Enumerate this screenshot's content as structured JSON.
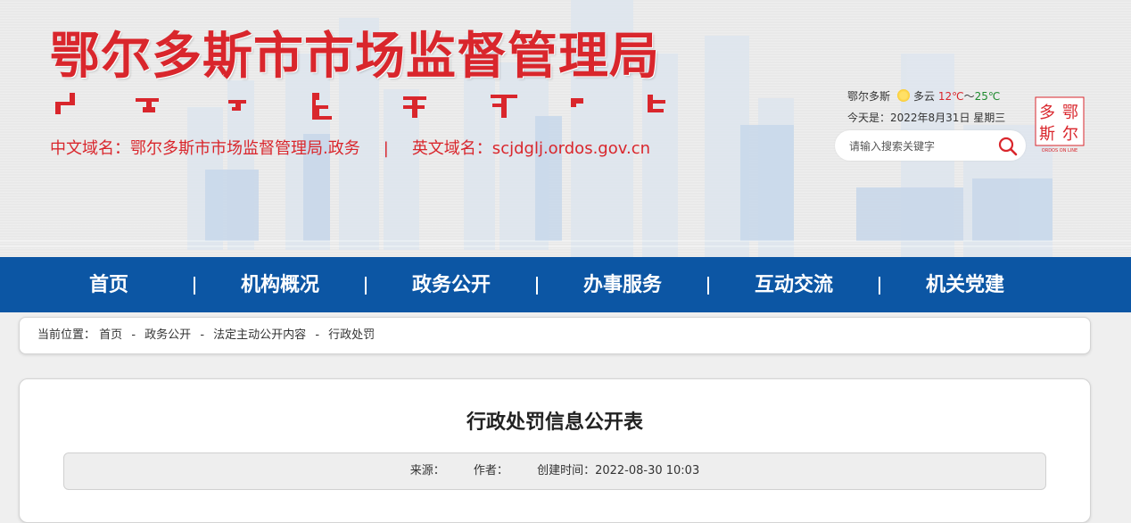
{
  "header": {
    "site_title": "鄂尔多斯市市场监督管理局",
    "cn_domain": "中文域名：鄂尔多斯市市场监督管理局.政务",
    "separator": "|",
    "en_domain": "英文域名：scjdglj.ordos.gov.cn",
    "seal_text": "ORDOS ON LINE",
    "seal_chars": [
      "鄂",
      "尔",
      "多",
      "斯"
    ],
    "brand_color": "#d9262c"
  },
  "weather": {
    "city": "鄂尔多斯",
    "condition": "多云",
    "low": "12℃",
    "tilde": "～",
    "high": "25℃",
    "date_line": "今天是：2022年8月31日 星期三",
    "icon": "sun-cloud-icon"
  },
  "search": {
    "placeholder": "请输入搜索关键字",
    "icon": "search-icon"
  },
  "nav": {
    "items": [
      {
        "label": "首页"
      },
      {
        "label": "机构概况"
      },
      {
        "label": "政务公开"
      },
      {
        "label": "办事服务"
      },
      {
        "label": "互动交流"
      },
      {
        "label": "机关党建"
      }
    ],
    "bg_color": "#0c56a4"
  },
  "breadcrumb": {
    "prefix": "当前位置：",
    "items": [
      "首页",
      "政务公开",
      "法定主动公开内容",
      "行政处罚"
    ],
    "dash": "-"
  },
  "article": {
    "title": "行政处罚信息公开表",
    "source_label": "来源：",
    "author_label": "作者：",
    "created_label": "创建时间：",
    "created_value": "2022-08-30 10:03"
  }
}
